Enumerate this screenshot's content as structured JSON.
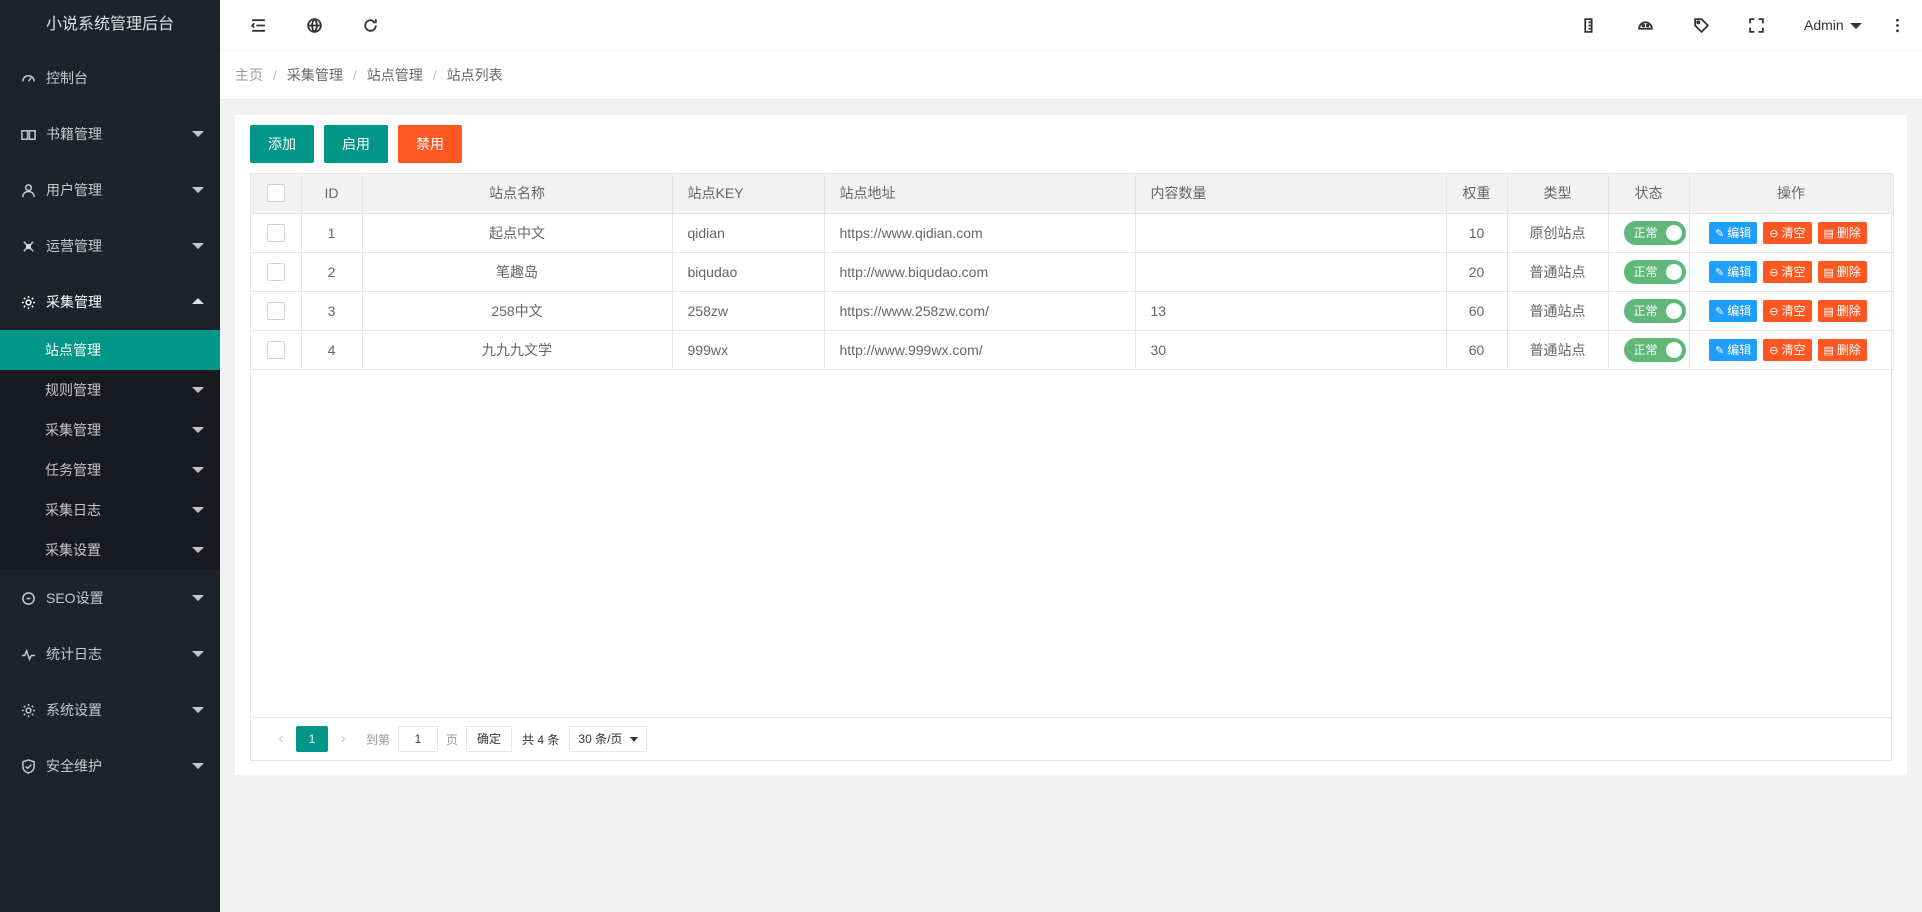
{
  "app": {
    "title": "小说系统管理后台"
  },
  "sidebar": {
    "items": [
      {
        "label": "控制台",
        "icon": "dashboard-icon"
      },
      {
        "label": "书籍管理",
        "icon": "book-icon"
      },
      {
        "label": "用户管理",
        "icon": "user-icon"
      },
      {
        "label": "运营管理",
        "icon": "operations-icon"
      },
      {
        "label": "采集管理",
        "icon": "gear-icon",
        "expanded": true
      },
      {
        "label": "SEO设置",
        "icon": "seo-icon"
      },
      {
        "label": "统计日志",
        "icon": "stats-icon"
      },
      {
        "label": "系统设置",
        "icon": "settings-icon"
      },
      {
        "label": "安全维护",
        "icon": "shield-icon"
      }
    ],
    "submenu": [
      {
        "label": "站点管理",
        "active": true
      },
      {
        "label": "规则管理"
      },
      {
        "label": "采集管理"
      },
      {
        "label": "任务管理"
      },
      {
        "label": "采集日志"
      },
      {
        "label": "采集设置"
      }
    ]
  },
  "header": {
    "user": "Admin",
    "icons": [
      "collapse-menu-icon",
      "globe-icon",
      "refresh-icon",
      "note-icon",
      "theme-icon",
      "tag-icon",
      "fullscreen-icon",
      "more-icon"
    ]
  },
  "breadcrumb": [
    "主页",
    "采集管理",
    "站点管理",
    "站点列表"
  ],
  "toolbar": {
    "add": "添加",
    "enable": "启用",
    "disable": "禁用"
  },
  "table": {
    "headers": [
      "ID",
      "站点名称",
      "站点KEY",
      "站点地址",
      "内容数量",
      "权重",
      "类型",
      "状态",
      "操作"
    ],
    "rows": [
      {
        "id": "1",
        "name": "起点中文",
        "key": "qidian",
        "url": "https://www.qidian.com",
        "count": "",
        "weight": "10",
        "type": "原创站点",
        "status": "正常"
      },
      {
        "id": "2",
        "name": "笔趣岛",
        "key": "biqudao",
        "url": "http://www.biqudao.com",
        "count": "",
        "weight": "20",
        "type": "普通站点",
        "status": "正常"
      },
      {
        "id": "3",
        "name": "258中文",
        "key": "258zw",
        "url": "https://www.258zw.com/",
        "count": "13",
        "weight": "60",
        "type": "普通站点",
        "status": "正常"
      },
      {
        "id": "4",
        "name": "九九九文学",
        "key": "999wx",
        "url": "http://www.999wx.com/",
        "count": "30",
        "weight": "60",
        "type": "普通站点",
        "status": "正常"
      }
    ],
    "actions": {
      "edit": "编辑",
      "clear": "清空",
      "delete": "删除"
    }
  },
  "pager": {
    "current": "1",
    "goto_prefix": "到第",
    "goto_value": "1",
    "goto_suffix": "页",
    "confirm": "确定",
    "total": "共 4 条",
    "page_size": "30 条/页"
  },
  "colors": {
    "primary": "#009688",
    "danger": "#ff5722",
    "info": "#1e9fff",
    "switch_on": "#5fb878",
    "sidebar": "#20222a"
  }
}
